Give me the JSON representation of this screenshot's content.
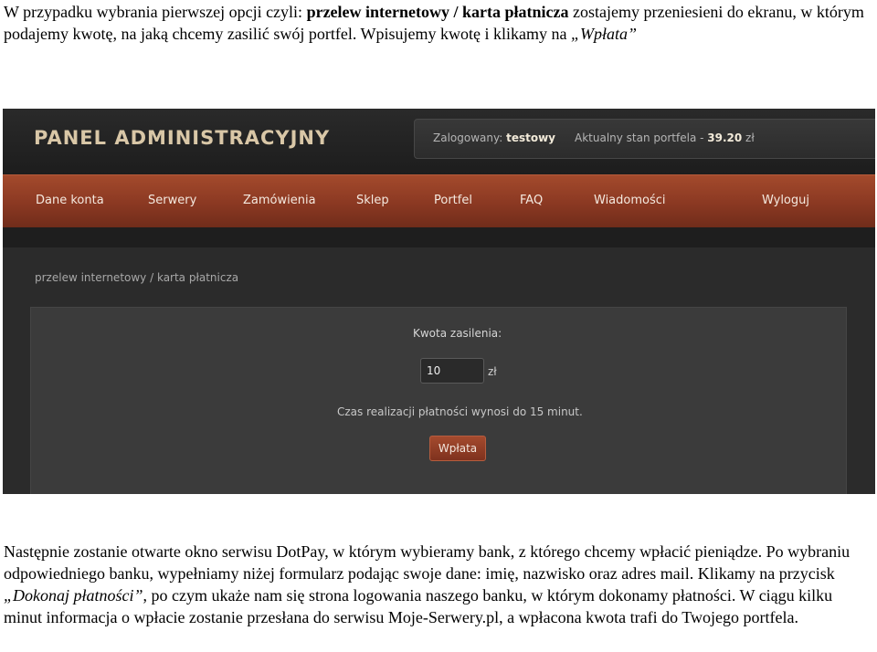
{
  "para1": {
    "intro": "W przypadku wybrania pierwszej opcji czyli: ",
    "option_bold": "przelew internetowy / karta płatnicza",
    "rest": " zostajemy przeniesieni do ekranu, w którym podajemy kwotę, na jaką chcemy zasilić swój portfel. Wpisujemy kwotę i klikamy na ",
    "button_ref": "„Wpłata”"
  },
  "panel": {
    "brand": "PANEL ADMINISTRACYJNY",
    "logged_label": "Zalogowany: ",
    "username": "testowy",
    "wallet_label": "Aktualny stan portfela - ",
    "wallet_value": "39.20",
    "wallet_currency": " zł",
    "nav": [
      "Dane konta",
      "Serwery",
      "Zamówienia",
      "Sklep",
      "Portfel",
      "FAQ",
      "Wiadomości",
      "Wyloguj"
    ],
    "breadcrumb": "przelew internetowy / karta płatnicza",
    "form": {
      "amount_label": "Kwota zasilenia:",
      "amount_value": "10",
      "currency": "zł",
      "time_note": "Czas realizacji płatności wynosi do 15 minut.",
      "submit_label": "Wpłata"
    }
  },
  "para2": {
    "part1": "Następnie zostanie otwarte okno serwisu DotPay, w którym wybieramy bank, z którego chcemy wpłacić pieniądze. Po wybraniu odpowiedniego banku, wypełniamy niżej formularz podając swoje dane: imię, nazwisko oraz adres mail. Klikamy na przycisk ",
    "button_ref": "„Dokonaj płatności”",
    "part2": ", po czym ukaże nam się strona logowania naszego banku, w którym dokonamy płatności. W ciągu kilku minut informacja o wpłacie zostanie przesłana do serwisu Moje-Serwery.pl, a wpłacona kwota trafi do Twojego portfela."
  }
}
